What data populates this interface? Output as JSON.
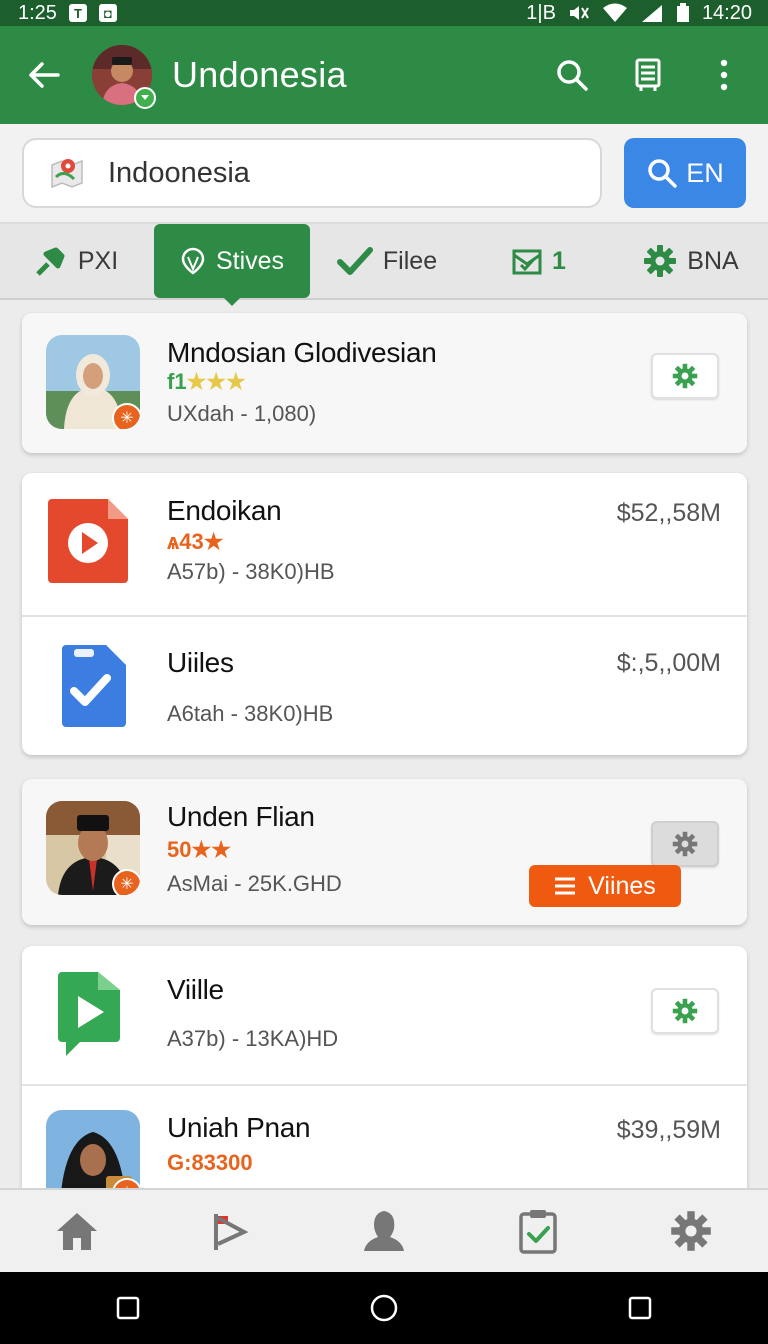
{
  "status_bar": {
    "time": "1:25",
    "notification_a": "T",
    "network": "1|B",
    "clock": "14:20"
  },
  "app_bar": {
    "title": "Undonesia"
  },
  "search": {
    "value": "Indoonesia",
    "button_label": "EN"
  },
  "tabs": [
    {
      "label": "PXI"
    },
    {
      "label": "Stives"
    },
    {
      "label": "Filee"
    },
    {
      "label": "1"
    },
    {
      "label": "BNA"
    }
  ],
  "cards": {
    "c1": {
      "title": "Mndosian Glodivesian",
      "rating": "f1",
      "stars": "★★★",
      "sub": "UXdah - 1,080)"
    },
    "c2a": {
      "title": "Endoikan",
      "rating": "ѧ43",
      "stars": "★",
      "sub": "A57b) - 38K0)HB",
      "price": "$52,,58M"
    },
    "c2b": {
      "title": "Uiiles",
      "sub": "A6tah - 38K0)HB",
      "price": "$:,5,,00M"
    },
    "c3": {
      "title": "Unden Flian",
      "rating": "50",
      "stars": "★★",
      "sub": "AsMai - 25K.GHD",
      "button": "Viines"
    },
    "c4a": {
      "title": "Viille",
      "sub": "A37b) - 13KA)HD"
    },
    "c4b": {
      "title": "Uniah Pnan",
      "rating": "G:83300",
      "price": "$39,,59M"
    }
  },
  "colors": {
    "primary": "#2e8b46",
    "primary_dark": "#1d5e2d",
    "accent_blue": "#3b87e6",
    "accent_orange": "#ef5a10",
    "star_yellow": "#e6c84a"
  },
  "icons": {
    "app_bar": [
      "back-arrow-icon",
      "search-icon",
      "book-icon",
      "more-vert-icon"
    ],
    "bottom_nav": [
      "home-icon",
      "flag-icon",
      "person-icon",
      "clipboard-check-icon",
      "settings-gear-icon"
    ],
    "system_nav": [
      "recents-square-icon",
      "home-circle-icon",
      "back-square-icon"
    ]
  }
}
